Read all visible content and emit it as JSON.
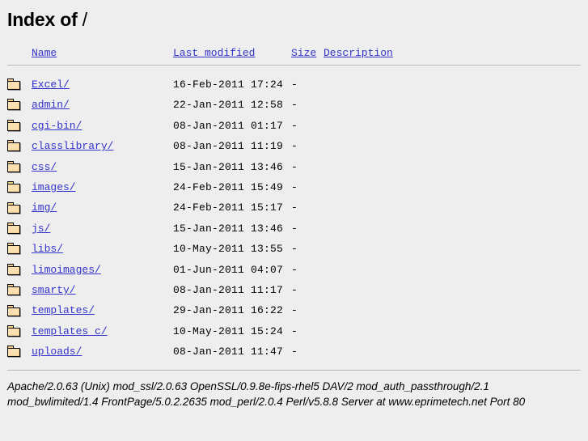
{
  "page": {
    "title_prefix": "Index of",
    "title_path": "/"
  },
  "table": {
    "headers": {
      "name": "Name",
      "last_modified": "Last modified",
      "size": "Size",
      "description": "Description"
    },
    "rows": [
      {
        "icon": "folder-icon",
        "name": "Excel/",
        "last_modified": "16-Feb-2011 17:24",
        "size": "-",
        "description": ""
      },
      {
        "icon": "folder-icon",
        "name": "admin/",
        "last_modified": "22-Jan-2011 12:58",
        "size": "-",
        "description": ""
      },
      {
        "icon": "folder-icon",
        "name": "cgi-bin/",
        "last_modified": "08-Jan-2011 01:17",
        "size": "-",
        "description": ""
      },
      {
        "icon": "folder-icon",
        "name": "classlibrary/",
        "last_modified": "08-Jan-2011 11:19",
        "size": "-",
        "description": ""
      },
      {
        "icon": "folder-icon",
        "name": "css/",
        "last_modified": "15-Jan-2011 13:46",
        "size": "-",
        "description": ""
      },
      {
        "icon": "folder-icon",
        "name": "images/",
        "last_modified": "24-Feb-2011 15:49",
        "size": "-",
        "description": ""
      },
      {
        "icon": "folder-icon",
        "name": "img/",
        "last_modified": "24-Feb-2011 15:17",
        "size": "-",
        "description": ""
      },
      {
        "icon": "folder-icon",
        "name": "js/",
        "last_modified": "15-Jan-2011 13:46",
        "size": "-",
        "description": ""
      },
      {
        "icon": "folder-icon",
        "name": "libs/",
        "last_modified": "10-May-2011 13:55",
        "size": "-",
        "description": ""
      },
      {
        "icon": "folder-icon",
        "name": "limoimages/",
        "last_modified": "01-Jun-2011 04:07",
        "size": "-",
        "description": ""
      },
      {
        "icon": "folder-icon",
        "name": "smarty/",
        "last_modified": "08-Jan-2011 11:17",
        "size": "-",
        "description": ""
      },
      {
        "icon": "folder-icon",
        "name": "templates/",
        "last_modified": "29-Jan-2011 16:22",
        "size": "-",
        "description": ""
      },
      {
        "icon": "folder-icon",
        "name": "templates_c/",
        "last_modified": "10-May-2011 15:24",
        "size": "-",
        "description": ""
      },
      {
        "icon": "folder-icon",
        "name": "uploads/",
        "last_modified": "08-Jan-2011 11:47",
        "size": "-",
        "description": ""
      }
    ]
  },
  "footer": {
    "signature": "Apache/2.0.63 (Unix) mod_ssl/2.0.63 OpenSSL/0.9.8e-fips-rhel5 DAV/2 mod_auth_passthrough/2.1 mod_bwlimited/1.4 FrontPage/5.0.2.2635 mod_perl/2.0.4 Perl/v5.8.8 Server at www.eprimetech.net Port 80"
  },
  "colors": {
    "background": "#eeeeee",
    "link": "#3333cc",
    "text": "#000000",
    "rule": "#b4b4b4",
    "folder_fill": "#f5cf91"
  }
}
